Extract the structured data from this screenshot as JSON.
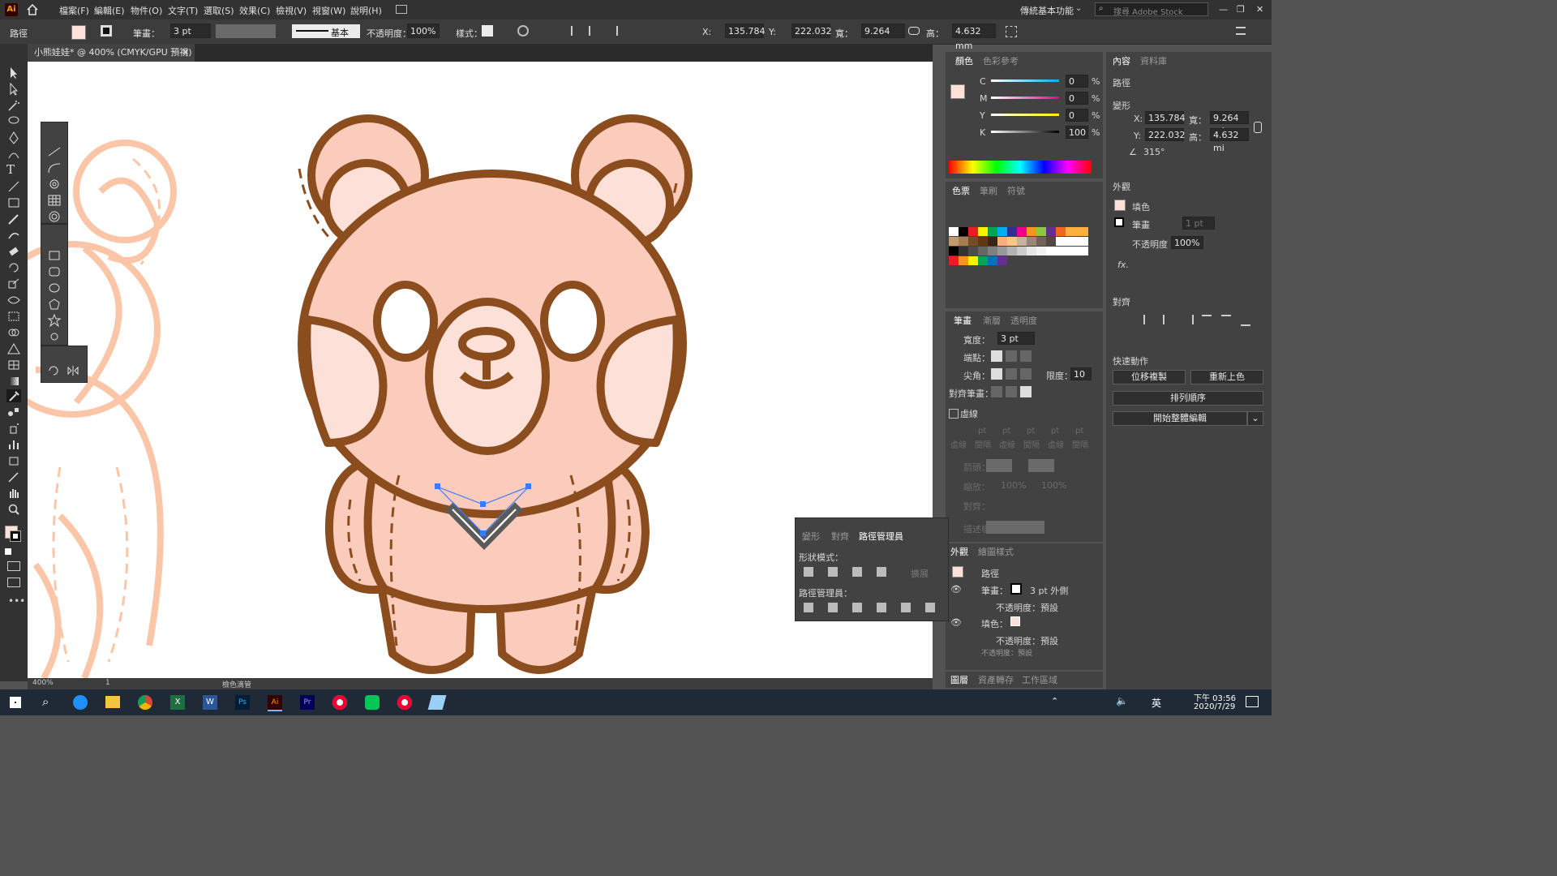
{
  "app": {
    "logo": "Ai"
  },
  "menu": [
    "檔案(F)",
    "編輯(E)",
    "物件(O)",
    "文字(T)",
    "選取(S)",
    "效果(C)",
    "檢視(V)",
    "視窗(W)",
    "說明(H)"
  ],
  "workspace": {
    "name": "傳統基本功能",
    "search_placeholder": "搜尋 Adobe Stock"
  },
  "control": {
    "object_type": "路徑",
    "stroke_label": "筆畫：",
    "stroke_value": "3 pt",
    "profile": "基本",
    "opacity_label": "不透明度：",
    "opacity_value": "100%",
    "style_label": "樣式：",
    "x_label": "X:",
    "x_value": "135.784 r",
    "y_label": "Y:",
    "y_value": "222.032 r",
    "w_label": "寬：",
    "w_value": "9.264 mm",
    "h_label": "高：",
    "h_value": "4.632 mm"
  },
  "document": {
    "tab_title": "小熊娃娃* @ 400% (CMYK/GPU 預視)"
  },
  "status": {
    "zoom": "400%",
    "artboard": "1",
    "tool": "檢色滴管"
  },
  "colors": {
    "bear_fill": "#fbcbbb",
    "bear_stroke": "#8b4c1e",
    "inner_fill": "#fde0d8",
    "bg_bear": "#fbc6a8",
    "selection": "#3a7afe"
  },
  "color_panel": {
    "tabs": [
      "顏色",
      "色彩參考"
    ],
    "channels": [
      {
        "name": "C",
        "value": "0",
        "unit": "%"
      },
      {
        "name": "M",
        "value": "0",
        "unit": "%"
      },
      {
        "name": "Y",
        "value": "0",
        "unit": "%"
      },
      {
        "name": "K",
        "value": "100",
        "unit": "%"
      }
    ]
  },
  "swatches_panel": {
    "tabs": [
      "色票",
      "筆刷",
      "符號"
    ]
  },
  "stroke_panel": {
    "tabs": [
      "筆畫",
      "漸層",
      "透明度"
    ],
    "weight_label": "寬度：",
    "weight": "3 pt",
    "cap_label": "端點：",
    "corner_label": "尖角：",
    "limit_label": "限度：",
    "limit": "10",
    "align_label": "對齊筆畫：",
    "dashed_label": "虛線",
    "dash_fields": [
      "pt",
      "pt",
      "pt",
      "pt",
      "pt",
      "pt"
    ],
    "dash_sub": [
      "虛線",
      "間隔",
      "虛線",
      "間隔",
      "虛線",
      "間隔"
    ],
    "arrow_label": "箭頭：",
    "scale_label": "縮放：",
    "scale1": "100%",
    "scale2": "100%",
    "align2_label": "對齊：",
    "profile_label": "描述檔："
  },
  "appearance_bottom": {
    "tabs": [
      "外觀",
      "繪圖樣式"
    ],
    "object": "路徑",
    "stroke_label": "筆畫：",
    "stroke_value": "3 pt 外側",
    "opacity1": "不透明度：預設",
    "fill_label": "填色：",
    "opacity2": "不透明度：預設",
    "opacity3": "不透明度：預設"
  },
  "pathfinder_panel": {
    "tabs": [
      "變形",
      "對齊",
      "路徑管理員"
    ],
    "shape_modes": "形狀模式：",
    "expand": "擴展",
    "pathfinders": "路徑管理員："
  },
  "layers_tabs": [
    "圖層",
    "資產轉存",
    "工作區域"
  ],
  "properties": {
    "tabs": [
      "內容",
      "資料庫"
    ],
    "object": "路徑",
    "transform_title": "變形",
    "x_label": "X:",
    "x": "135.784",
    "y_label": "Y:",
    "y": "222.032",
    "w_label": "寬：",
    "w": "9.264 mi",
    "h_label": "高：",
    "h": "4.632 mi",
    "angle": "315°",
    "appearance_title": "外觀",
    "fill_label": "填色",
    "stroke_label": "筆畫",
    "stroke_value": "1 pt",
    "opacity_label": "不透明度",
    "opacity_value": "100%",
    "fx": "fx.",
    "align_title": "對齊",
    "quick_actions_title": "快速動作",
    "btn_offset": "位移複製",
    "btn_recolor": "重新上色",
    "btn_arrange": "排列順序",
    "btn_isolate": "開始整體編輯"
  },
  "taskbar": {
    "time": "下午 03:56",
    "date": "2020/7/29",
    "ime": "英"
  }
}
